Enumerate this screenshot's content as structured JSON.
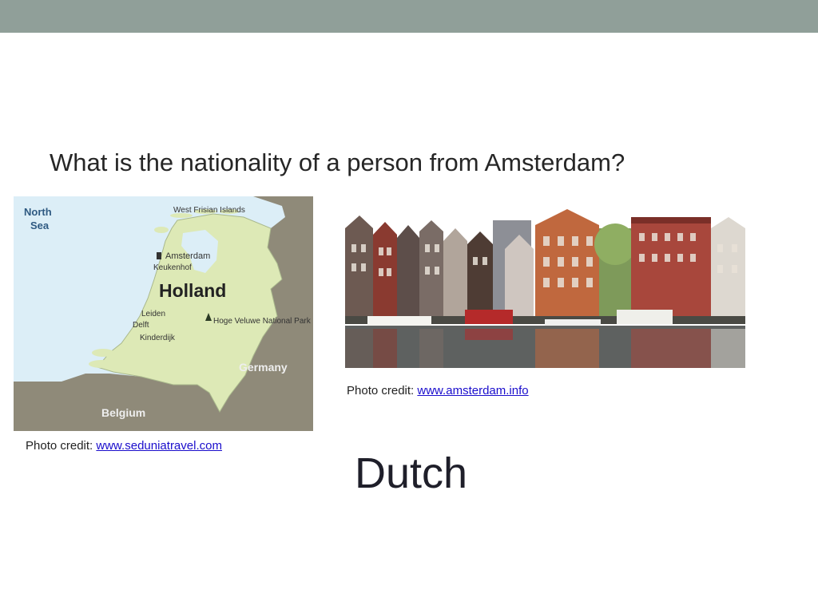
{
  "slide": {
    "question": "What is the nationality of a person from Amsterdam?",
    "answer": "Dutch"
  },
  "map": {
    "labels": {
      "north_sea_line1": "North",
      "north_sea_line2": "Sea",
      "west_frisian": "West Frisian Islands",
      "amsterdam": "Amsterdam",
      "keukenhof": "Keukenhof",
      "holland": "Holland",
      "leiden": "Leiden",
      "delft": "Delft",
      "kinderdijk": "Kinderdijk",
      "hoge_veluwe": "Hoge Veluwe National Park",
      "germany": "Germany",
      "belgium": "Belgium"
    },
    "colors": {
      "sea": "#dceef7",
      "land": "#dde9b6",
      "neighbors": "#8f8a79"
    }
  },
  "credits": {
    "map_prefix": "Photo credit: ",
    "map_link": "www.seduniatravel.com",
    "photo_prefix": "Photo credit: ",
    "photo_link": "www.amsterdam.info"
  }
}
